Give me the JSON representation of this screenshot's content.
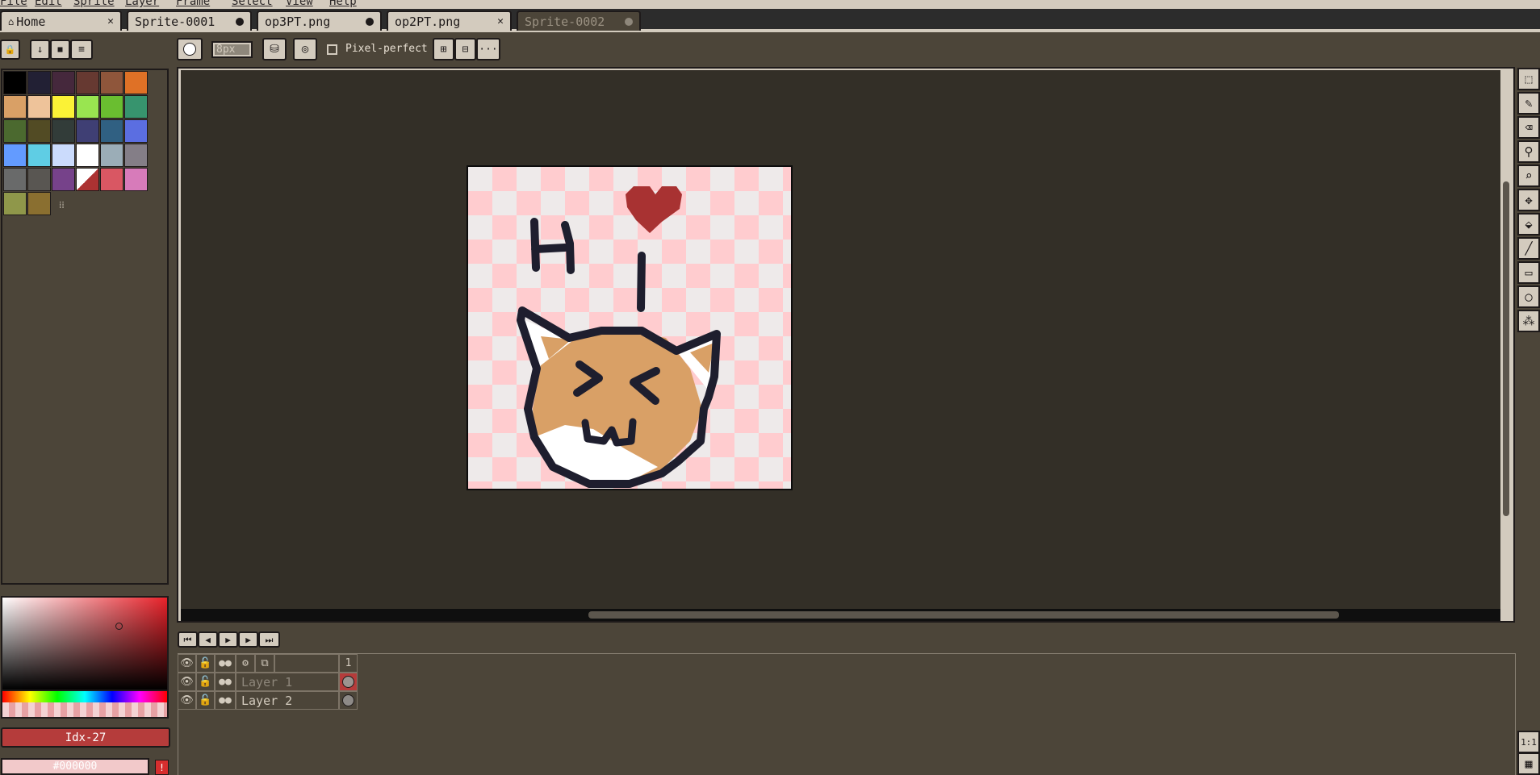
{
  "menubar": {
    "items": [
      "File",
      "Edit",
      "Sprite",
      "Layer",
      "Frame",
      "Select",
      "View",
      "Help"
    ]
  },
  "tabs": [
    {
      "label": "Home",
      "status": "close"
    },
    {
      "label": "Sprite-0001",
      "status": "modified"
    },
    {
      "label": "op3PT.png",
      "status": "modified"
    },
    {
      "label": "op2PT.png",
      "status": "close"
    },
    {
      "label": "Sprite-0002",
      "status": "modified"
    }
  ],
  "palette_toolbar": {
    "lock": "🔒",
    "sort": "↓",
    "save": "■",
    "options": "≡"
  },
  "tool_options": {
    "brush_size": "8px",
    "pixel_perfect": "Pixel-perfect",
    "more": "···"
  },
  "palette": {
    "colors": [
      "#000000",
      "#222034",
      "#45283c",
      "#663931",
      "#8f563b",
      "#df7126",
      "#d9a066",
      "#eec39a",
      "#fbf236",
      "#99e550",
      "#6abe30",
      "#37946e",
      "#4b692f",
      "#524b24",
      "#323c39",
      "#3f3f74",
      "#306082",
      "#5b6ee1",
      "#639bff",
      "#5fcde4",
      "#cbdbfc",
      "#ffffff",
      "#9badb7",
      "#847e87",
      "#696a6a",
      "#595652",
      "#76428a",
      "#ac3232",
      "#d95763",
      "#d77bba",
      "#8f974a",
      "#8a6f30"
    ],
    "resize_handle": "⁞⁞"
  },
  "color_bar": {
    "index_label": "Idx-27",
    "hex_label": "#000000",
    "warning": "!"
  },
  "right_tools": [
    "selection-icon",
    "pencil-icon",
    "eraser-icon",
    "eyedropper-icon",
    "zoom-icon",
    "move-icon",
    "paint-bucket-icon",
    "line-icon",
    "rectangle-icon",
    "ellipse-icon",
    "spray-icon"
  ],
  "right_tools_bottom": {
    "zoom_label": "1:1"
  },
  "timeline": {
    "frame_number": "1",
    "layers": [
      {
        "name": "Layer 1"
      },
      {
        "name": "Layer 2"
      }
    ]
  },
  "colors": {
    "panel_bg": "#4c4539",
    "chrome": "#d3cbbe",
    "canvas_bg": "#332f27",
    "accent": "#b53c3b"
  }
}
